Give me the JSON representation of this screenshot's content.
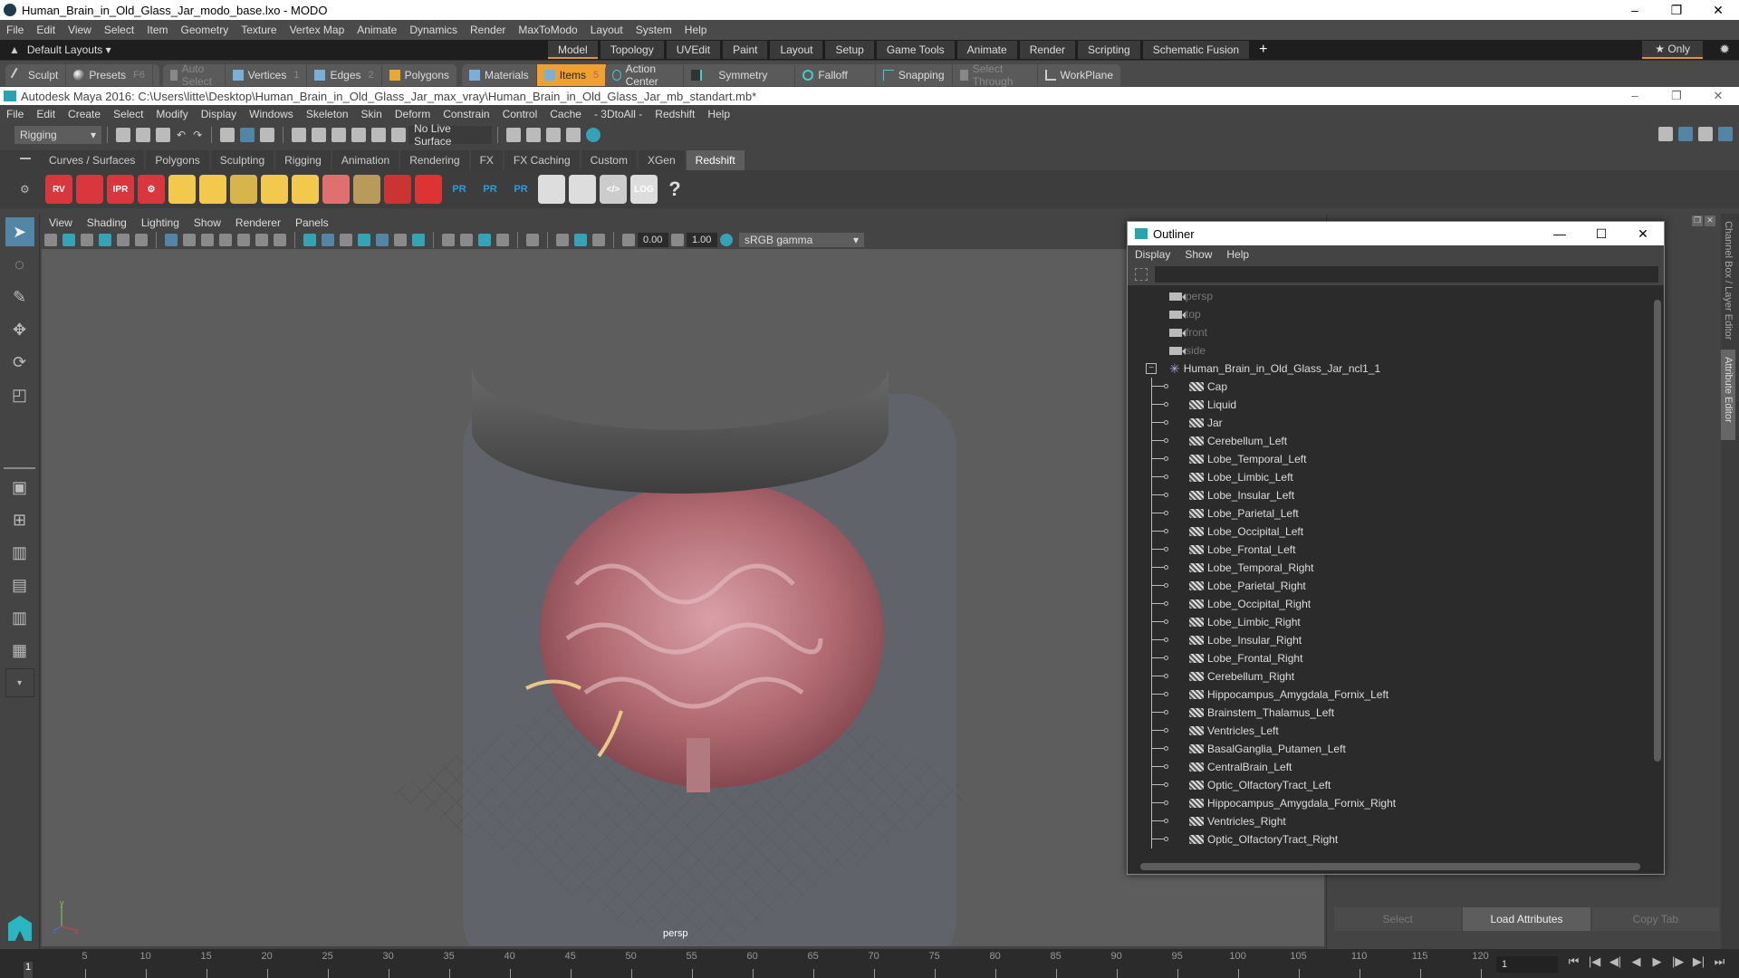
{
  "modo": {
    "title": "Human_Brain_in_Old_Glass_Jar_modo_base.lxo - MODO",
    "window_controls": [
      "–",
      "❐",
      "✕"
    ],
    "menu": [
      "File",
      "Edit",
      "View",
      "Select",
      "Item",
      "Geometry",
      "Texture",
      "Vertex Map",
      "Animate",
      "Dynamics",
      "Render",
      "MaxToModo",
      "Layout",
      "System",
      "Help"
    ],
    "layouts_label": "Default Layouts ▾",
    "layout_tabs": [
      "Model",
      "Topology",
      "UVEdit",
      "Paint",
      "Layout",
      "Setup",
      "Game Tools",
      "Animate",
      "Render",
      "Scripting",
      "Schematic Fusion"
    ],
    "active_layout": "Model",
    "add_tab": "+",
    "only_label": "★ Only",
    "toolbar": {
      "sculpt": "Sculpt",
      "presets": "Presets",
      "presets_key": "F6",
      "auto_select": "Auto Select",
      "vertices": "Vertices",
      "vertices_key": "1",
      "edges": "Edges",
      "edges_key": "2",
      "polygons": "Polygons",
      "materials": "Materials",
      "items": "Items",
      "items_key": "5",
      "action_center": "Action Center",
      "symmetry": "Symmetry",
      "falloff": "Falloff",
      "snapping": "Snapping",
      "select_through": "Select Through",
      "workplane": "WorkPlane"
    }
  },
  "maya": {
    "title": "Autodesk Maya 2016: C:\\Users\\litte\\Desktop\\Human_Brain_in_Old_Glass_Jar_max_vray\\Human_Brain_in_Old_Glass_Jar_mb_standart.mb*",
    "menu": [
      "File",
      "Edit",
      "Create",
      "Select",
      "Modify",
      "Display",
      "Windows",
      "Skeleton",
      "Skin",
      "Deform",
      "Constrain",
      "Control",
      "Cache",
      "- 3DtoAll -",
      "Redshift",
      "Help"
    ],
    "menuset": "Rigging",
    "live_surface": "No Live Surface",
    "shelf_tabs": [
      "Curves / Surfaces",
      "Polygons",
      "Sculpting",
      "Rigging",
      "Animation",
      "Rendering",
      "FX",
      "FX Caching",
      "Custom",
      "XGen",
      "Redshift"
    ],
    "active_shelf": "Redshift",
    "shelf_icons": [
      {
        "name": "rs-render-view-icon",
        "label": "RV",
        "color": "#d9363e"
      },
      {
        "name": "rs-batch-render-icon",
        "label": "",
        "color": "#d9363e"
      },
      {
        "name": "rs-ipr-icon",
        "label": "IPR",
        "color": "#d9363e"
      },
      {
        "name": "rs-settings-icon",
        "label": "⚙",
        "color": "#d9363e"
      },
      {
        "name": "rs-area-light-icon",
        "label": "",
        "color": "#f2c94c"
      },
      {
        "name": "rs-portal-light-icon",
        "label": "",
        "color": "#f2c94c"
      },
      {
        "name": "rs-ies-light-icon",
        "label": "",
        "color": "#d8b54a"
      },
      {
        "name": "rs-dome-light-icon",
        "label": "",
        "color": "#f2c94c"
      },
      {
        "name": "rs-sun-sky-icon",
        "label": "",
        "color": "#f2c94c"
      },
      {
        "name": "rs-proxy-icon",
        "label": "",
        "color": "#e07070"
      },
      {
        "name": "rs-hair-icon",
        "label": "",
        "color": "#b89a5a"
      },
      {
        "name": "rs-shader-icon",
        "label": "",
        "color": "#cc3333"
      },
      {
        "name": "rs-sphere-icon",
        "label": "",
        "color": "#dd3333"
      },
      {
        "name": "rs-pr-export-icon",
        "label": "PR",
        "color": "#2a9fd6"
      },
      {
        "name": "rs-pr-import-icon",
        "label": "PR",
        "color": "#2a9fd6"
      },
      {
        "name": "rs-pr-convert-icon",
        "label": "PR",
        "color": "#2a9fd6"
      },
      {
        "name": "rs-pies-icon",
        "label": "",
        "color": "#dddddd"
      },
      {
        "name": "rs-pie-icon",
        "label": "",
        "color": "#dddddd"
      },
      {
        "name": "rs-script-icon",
        "label": "</>",
        "color": "#cccccc"
      },
      {
        "name": "rs-log-icon",
        "label": "LOG",
        "color": "#dddddd"
      },
      {
        "name": "help-icon",
        "label": "?",
        "color": "#dddddd"
      }
    ],
    "viewport": {
      "menu": [
        "View",
        "Shading",
        "Lighting",
        "Show",
        "Renderer",
        "Panels"
      ],
      "exposure": "0.00",
      "gamma": "1.00",
      "color_space": "sRGB gamma",
      "camera_label": "persp",
      "axis": {
        "x": "x",
        "y": "y",
        "z": "z"
      }
    },
    "side_tabs": [
      "Channel Box / Layer Editor",
      "Attribute Editor"
    ],
    "active_side_tab": "Attribute Editor",
    "attr_buttons": [
      "Select",
      "Load Attributes",
      "Copy Tab"
    ],
    "active_attr_button": "Load Attributes"
  },
  "outliner": {
    "title": "Outliner",
    "window_controls": [
      "—",
      "☐",
      "✕"
    ],
    "menu": [
      "Display",
      "Show",
      "Help"
    ],
    "filter_placeholder": "",
    "cameras": [
      "persp",
      "top",
      "front",
      "side"
    ],
    "root": "Human_Brain_in_Old_Glass_Jar_ncl1_1",
    "children": [
      "Cap",
      "Liquid",
      "Jar",
      "Cerebellum_Left",
      "Lobe_Temporal_Left",
      "Lobe_Limbic_Left",
      "Lobe_Insular_Left",
      "Lobe_Parietal_Left",
      "Lobe_Occipital_Left",
      "Lobe_Frontal_Left",
      "Lobe_Temporal_Right",
      "Lobe_Parietal_Right",
      "Lobe_Occipital_Right",
      "Lobe_Limbic_Right",
      "Lobe_Insular_Right",
      "Lobe_Frontal_Right",
      "Cerebellum_Right",
      "Hippocampus_Amygdala_Fornix_Left",
      "Brainstem_Thalamus_Left",
      "Ventricles_Left",
      "BasalGanglia_Putamen_Left",
      "CentralBrain_Left",
      "Optic_OlfactoryTract_Left",
      "Hippocampus_Amygdala_Fornix_Right",
      "Ventricles_Right",
      "Optic_OlfactoryTract_Right"
    ]
  },
  "timeline": {
    "start_frame": "1",
    "ticks": [
      "5",
      "10",
      "15",
      "20",
      "25",
      "30",
      "35",
      "40",
      "45",
      "50",
      "55",
      "60",
      "65",
      "70",
      "75",
      "80",
      "85",
      "90",
      "95",
      "100",
      "105",
      "110",
      "115",
      "120"
    ],
    "current_frame": "1",
    "controls": [
      "⏮",
      "|◀",
      "◀|",
      "◀",
      "▶",
      "|▶",
      "▶|",
      "⏭"
    ]
  }
}
